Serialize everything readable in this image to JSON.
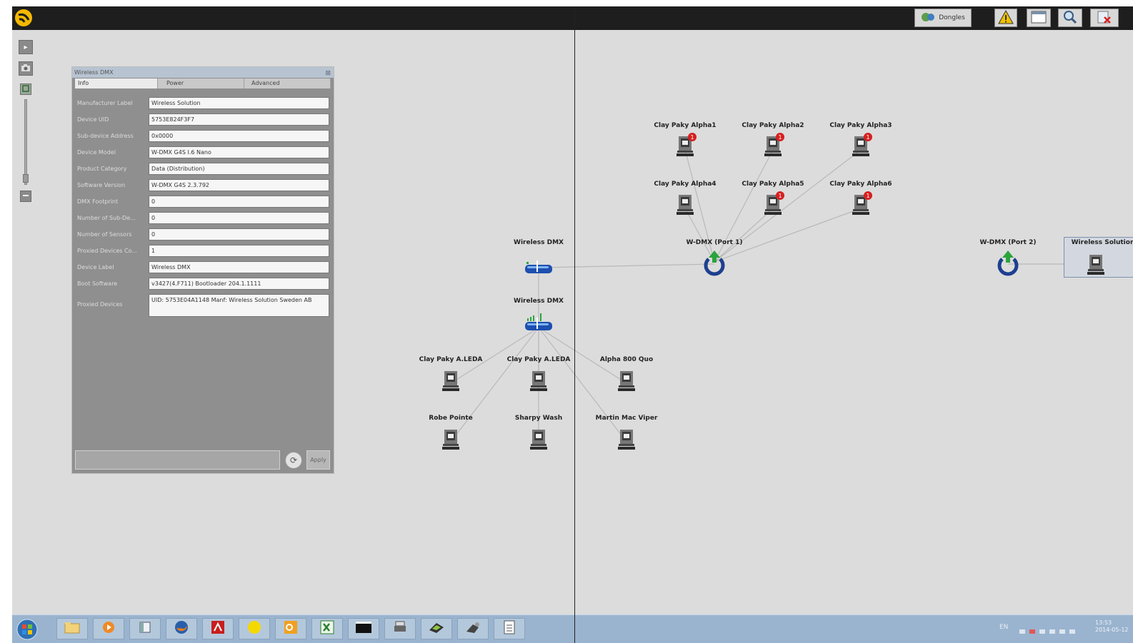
{
  "topbar": {
    "dongles_label": "Dongles",
    "icons": [
      "app-logo-icon",
      "dongles-icon",
      "warning-icon",
      "window-icon",
      "search-icon",
      "close-icon"
    ]
  },
  "left_toolbar": {
    "icons": [
      "play-icon",
      "camera-icon",
      "zoom-in-icon",
      "zoom-out-icon"
    ],
    "zoom_level": 0.1
  },
  "panel": {
    "title": "Wireless DMX",
    "tabs": [
      "Info",
      "Power",
      "Advanced"
    ],
    "active_tab": "Info",
    "rows": [
      {
        "label": "Manufacturer Label",
        "value": "Wireless Solution"
      },
      {
        "label": "Device UID",
        "value": "5753E824F3F7"
      },
      {
        "label": "Sub-device Address",
        "value": "0x0000"
      },
      {
        "label": "Device Model",
        "value": "W-DMX G4S I.6 Nano"
      },
      {
        "label": "Product Category",
        "value": "Data (Distribution)"
      },
      {
        "label": "Software Version",
        "value": "W-DMX G4S 2.3.792"
      },
      {
        "label": "DMX Footprint",
        "value": "0"
      },
      {
        "label": "Number of Sub-De...",
        "value": "0"
      },
      {
        "label": "Number of Sensors",
        "value": "0"
      },
      {
        "label": "Proxied Devices Co...",
        "value": "1"
      },
      {
        "label": "Device Label",
        "value": "Wireless DMX"
      },
      {
        "label": "Boot Software",
        "value": "v3427(4.F711) Bootloader 204.1.1111"
      },
      {
        "label": "Proxied Devices",
        "value": "UID: 5753E04A1148 Manf: Wireless Solution Sweden AB"
      }
    ],
    "apply_label": "Apply"
  },
  "network": {
    "nodes": [
      {
        "label": "Wireless DMX",
        "type": "transmitter"
      },
      {
        "label": "Wireless DMX",
        "type": "receiver"
      },
      {
        "label": "W-DMX (Port 1)",
        "type": "port"
      },
      {
        "label": "W-DMX (Port 2)",
        "type": "port"
      },
      {
        "label": "Wireless Solution",
        "type": "fixture"
      },
      {
        "label": "Clay Paky Alpha1",
        "type": "fixture",
        "badge": "1"
      },
      {
        "label": "Clay Paky Alpha2",
        "type": "fixture",
        "badge": "1"
      },
      {
        "label": "Clay Paky Alpha3",
        "type": "fixture",
        "badge": "1"
      },
      {
        "label": "Clay Paky Alpha4",
        "type": "fixture"
      },
      {
        "label": "Clay Paky Alpha5",
        "type": "fixture",
        "badge": "1"
      },
      {
        "label": "Clay Paky Alpha6",
        "type": "fixture",
        "badge": "1"
      },
      {
        "label": "Clay Paky A.LEDA",
        "type": "fixture"
      },
      {
        "label": "Clay Paky A.LEDA",
        "type": "fixture"
      },
      {
        "label": "Alpha 800 Quo",
        "type": "fixture"
      },
      {
        "label": "Robe Pointe",
        "type": "fixture"
      },
      {
        "label": "Sharpy Wash",
        "type": "fixture"
      },
      {
        "label": "Martin Mac Viper",
        "type": "fixture"
      }
    ]
  },
  "taskbar": {
    "icons": [
      "windows-start-icon",
      "folder-icon",
      "media-player-icon",
      "app-icon",
      "firefox-icon",
      "acrobat-icon",
      "sticky-notes-icon",
      "outlook-icon",
      "excel-icon",
      "terminal-icon",
      "printer-icon",
      "device-icon",
      "tool-icon",
      "notepad-icon"
    ],
    "tray_text": "EN",
    "clock_time": "13:53",
    "clock_date": "2014-05-12"
  },
  "colors": {
    "topbar": "#1e1e1e",
    "canvas": "#dcdcdc",
    "panel": "#8f8f8f",
    "taskbar": "#9ab4cf",
    "port_blue": "#1d3f8f",
    "arrow_green": "#2aa43c",
    "badge_red": "#d62020",
    "logo_yellow": "#f5b800"
  }
}
